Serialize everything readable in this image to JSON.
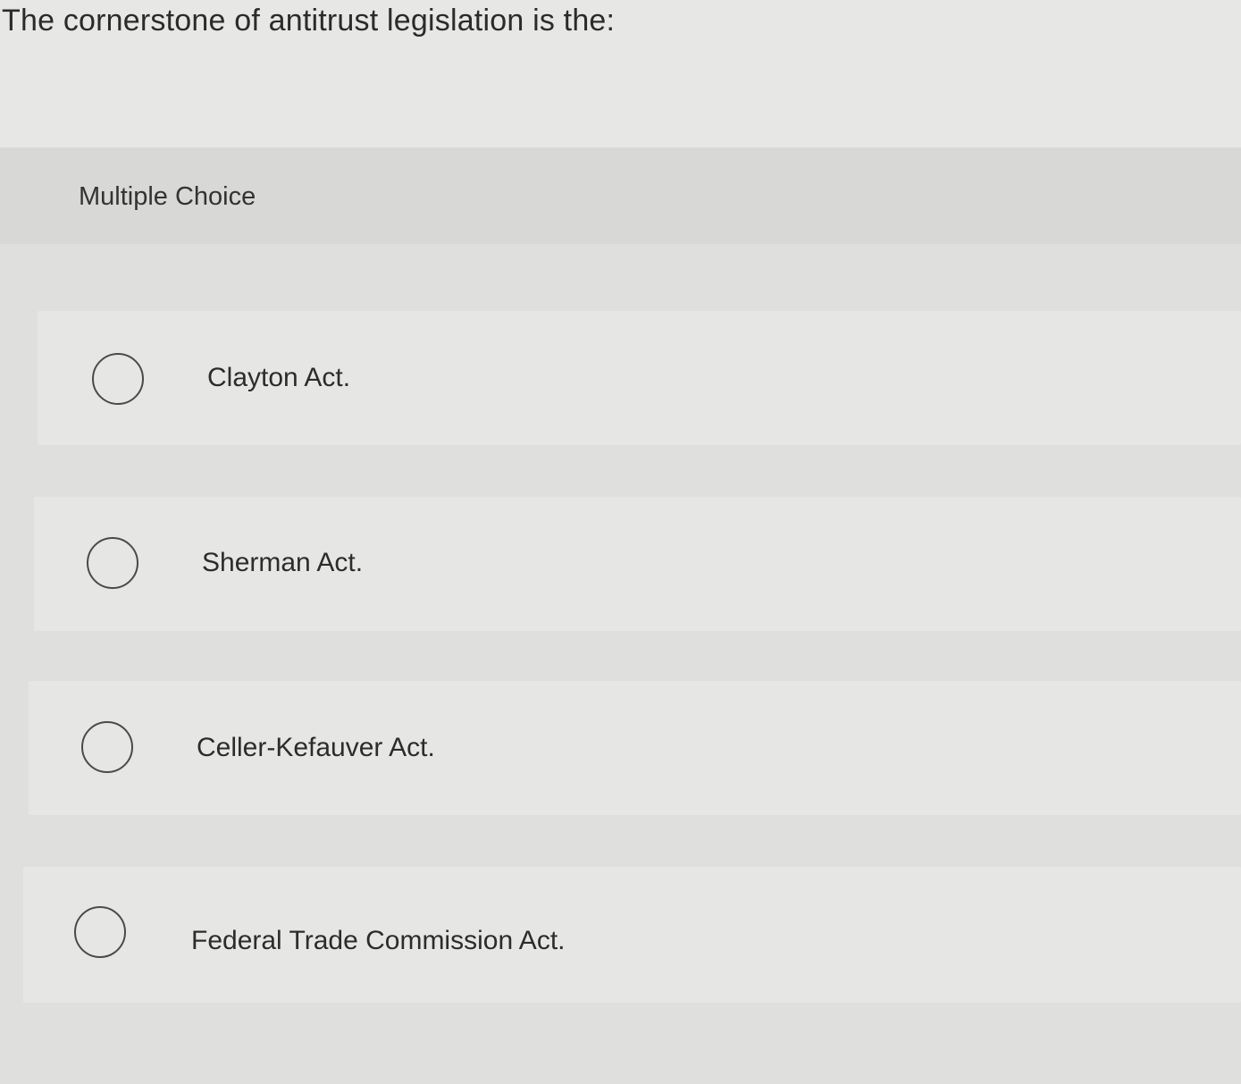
{
  "question": {
    "text": "The cornerstone of antitrust legislation is the:"
  },
  "question_type": {
    "label": "Multiple Choice"
  },
  "options": [
    {
      "label": "Clayton Act.",
      "selected": false
    },
    {
      "label": "Sherman Act.",
      "selected": false
    },
    {
      "label": "Celler-Kefauver Act.",
      "selected": false
    },
    {
      "label": "Federal Trade Commission Act.",
      "selected": false
    }
  ],
  "colors": {
    "background": "#e4e5e3",
    "band": "#d8d8d6",
    "option_card": "#e6e6e4",
    "text": "#2a2a2a",
    "radio_border": "#4a4a4a"
  }
}
